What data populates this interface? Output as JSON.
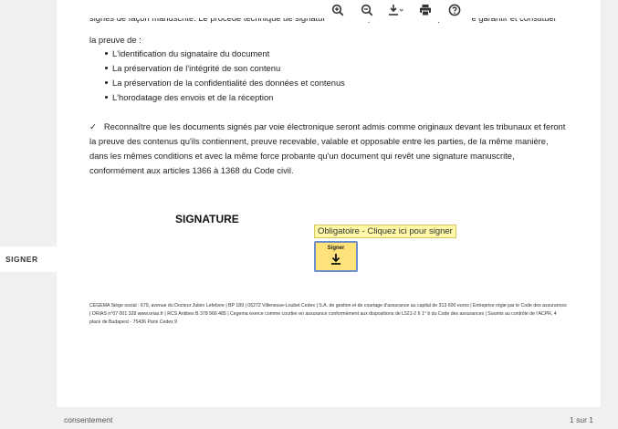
{
  "toolbar": {
    "icons": [
      "zoom-in-icon",
      "zoom-out-icon",
      "download-icon",
      "print-icon",
      "help-icon"
    ]
  },
  "document": {
    "cut_line": "signés de façon manuscrite. Le procédé technique de signature électronique mis en oeuvre permet de garantir et constituer",
    "intro": "la preuve de :",
    "bullets": [
      "L'identification du signataire du document",
      "La préservation de l'intégrité de son contenu",
      "La préservation de la confidentialité des données et contenus",
      "L'horodatage des envois et de la réception"
    ],
    "check_mark": "✓",
    "paragraph": "Reconnaître que les documents signés par voie électronique seront admis comme originaux devant les tribunaux et feront la preuve des contenus qu'ils contiennent, preuve recevable, valable et opposable entre les parties, de la même manière, dans les mêmes conditions et avec la même force probante qu'un document qui revêt une signature manuscrite, conformément aux articles 1366 à 1368 du Code civil.",
    "signature_heading": "SIGNATURE",
    "tooltip": "Obligatoire - Cliquez ici pour signer",
    "sign_button_label": "Signer",
    "footer": "CEGEMA Siège social : 679, avenue du Docteur Julien Lefebvre | BP 189 | 06272 Villeneuve-Loubet Cedex | S.A. de gestion et de courtage d'assurance au capital de 313 600 euros | Entreprise régie par le Code des assurances | ORIAS n°07 001 328 www.orias.fr | RCS Antibes B 378 966 485 | Cegema exerce comme courtier en assurance conformément aux dispositions de L521-2 II 1° b du Code des assurances | Soumis au contrôle de l'ACPR, 4 place de Budapest - 75436 Paris Cedex 9"
  },
  "side_tab": {
    "label": "SIGNER"
  },
  "status": {
    "section": "consentement",
    "page": "1 sur 1"
  }
}
